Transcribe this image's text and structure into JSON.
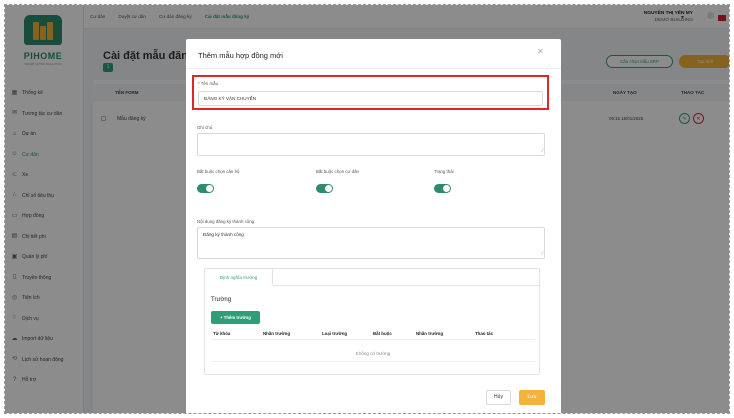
{
  "sidebar": {
    "logo_text": "PIHOME",
    "logo_sub": "SMART LIVING SOLUTION",
    "items": [
      {
        "label": "Thống kê",
        "icon": "dashboard-icon"
      },
      {
        "label": "Tương tác cư dân",
        "icon": "mail-icon"
      },
      {
        "label": "Dự án",
        "icon": "building-icon"
      },
      {
        "label": "Cư dân",
        "icon": "user-icon",
        "active": true
      },
      {
        "label": "Xe",
        "icon": "car-icon"
      },
      {
        "label": "Chỉ số tiêu thụ",
        "icon": "chart-icon"
      },
      {
        "label": "Hợp đồng",
        "icon": "folder-icon"
      },
      {
        "label": "Chi tiết phí",
        "icon": "receipt-icon"
      },
      {
        "label": "Quản lý phí",
        "icon": "wallet-icon"
      },
      {
        "label": "Truyền thông",
        "icon": "document-icon"
      },
      {
        "label": "Tiện ích",
        "icon": "utility-icon"
      },
      {
        "label": "Dịch vụ",
        "icon": "service-icon"
      },
      {
        "label": "Import dữ liệu",
        "icon": "cloud-icon"
      },
      {
        "label": "Lịch sử hoạn động",
        "icon": "history-icon"
      },
      {
        "label": "Hỗ trợ",
        "icon": "help-icon"
      }
    ]
  },
  "header": {
    "breadcrumbs": [
      "Cư dân",
      "Duyệt cư dân",
      "Cư dân đăng ký",
      "Cài đặt mẫu đăng ký"
    ],
    "user_name": "NGUYỄN THỊ YẾN MY",
    "user_org": "DEMO BUILDING",
    "notification_count": "3"
  },
  "page": {
    "title": "Cài đặt mẫu đăng ký",
    "count": "1",
    "sample_button": "Cấu chọn mẫu SRP",
    "new_button": "Tạo mới",
    "columns": {
      "name": "TÊN FORM",
      "created": "NGÀY TẠO",
      "actions": "THAO TÁC"
    },
    "row": {
      "name": "Mẫu đăng ký",
      "created": "09:15 15/01/2025"
    }
  },
  "modal": {
    "title": "Thêm mẫu hợp đồng mới",
    "name_label": "Tên mẫu",
    "name_value": "ĐĂNG KÝ VẬN CHUYỂN",
    "note_label": "Ghi chú",
    "toggle1_label": "Bắt buộc chọn căn hộ",
    "toggle2_label": "Bắt buộc chọn cư dân",
    "toggle3_label": "Trạng thái",
    "toggles": [
      true,
      true,
      true
    ],
    "success_label": "Nội dung đăng ký thành công",
    "success_value": "Đăng ký thành công",
    "tab_label": "Định nghĩa trường",
    "fields_title": "Trường",
    "add_field_button": "+ Thêm trường",
    "field_columns": [
      "Từ khóa",
      "Nhãn trường",
      "Loại trường",
      "Bắt buộc",
      "Nhãn trường",
      "Thao tác"
    ],
    "empty_text": "Không có trường",
    "cancel_button": "Hủy",
    "save_button": "Lưu"
  },
  "colors": {
    "accent": "#2e9e78",
    "brand": "#2e8b6e",
    "primary_button": "#f2b43a",
    "highlight": "#e0262b"
  }
}
